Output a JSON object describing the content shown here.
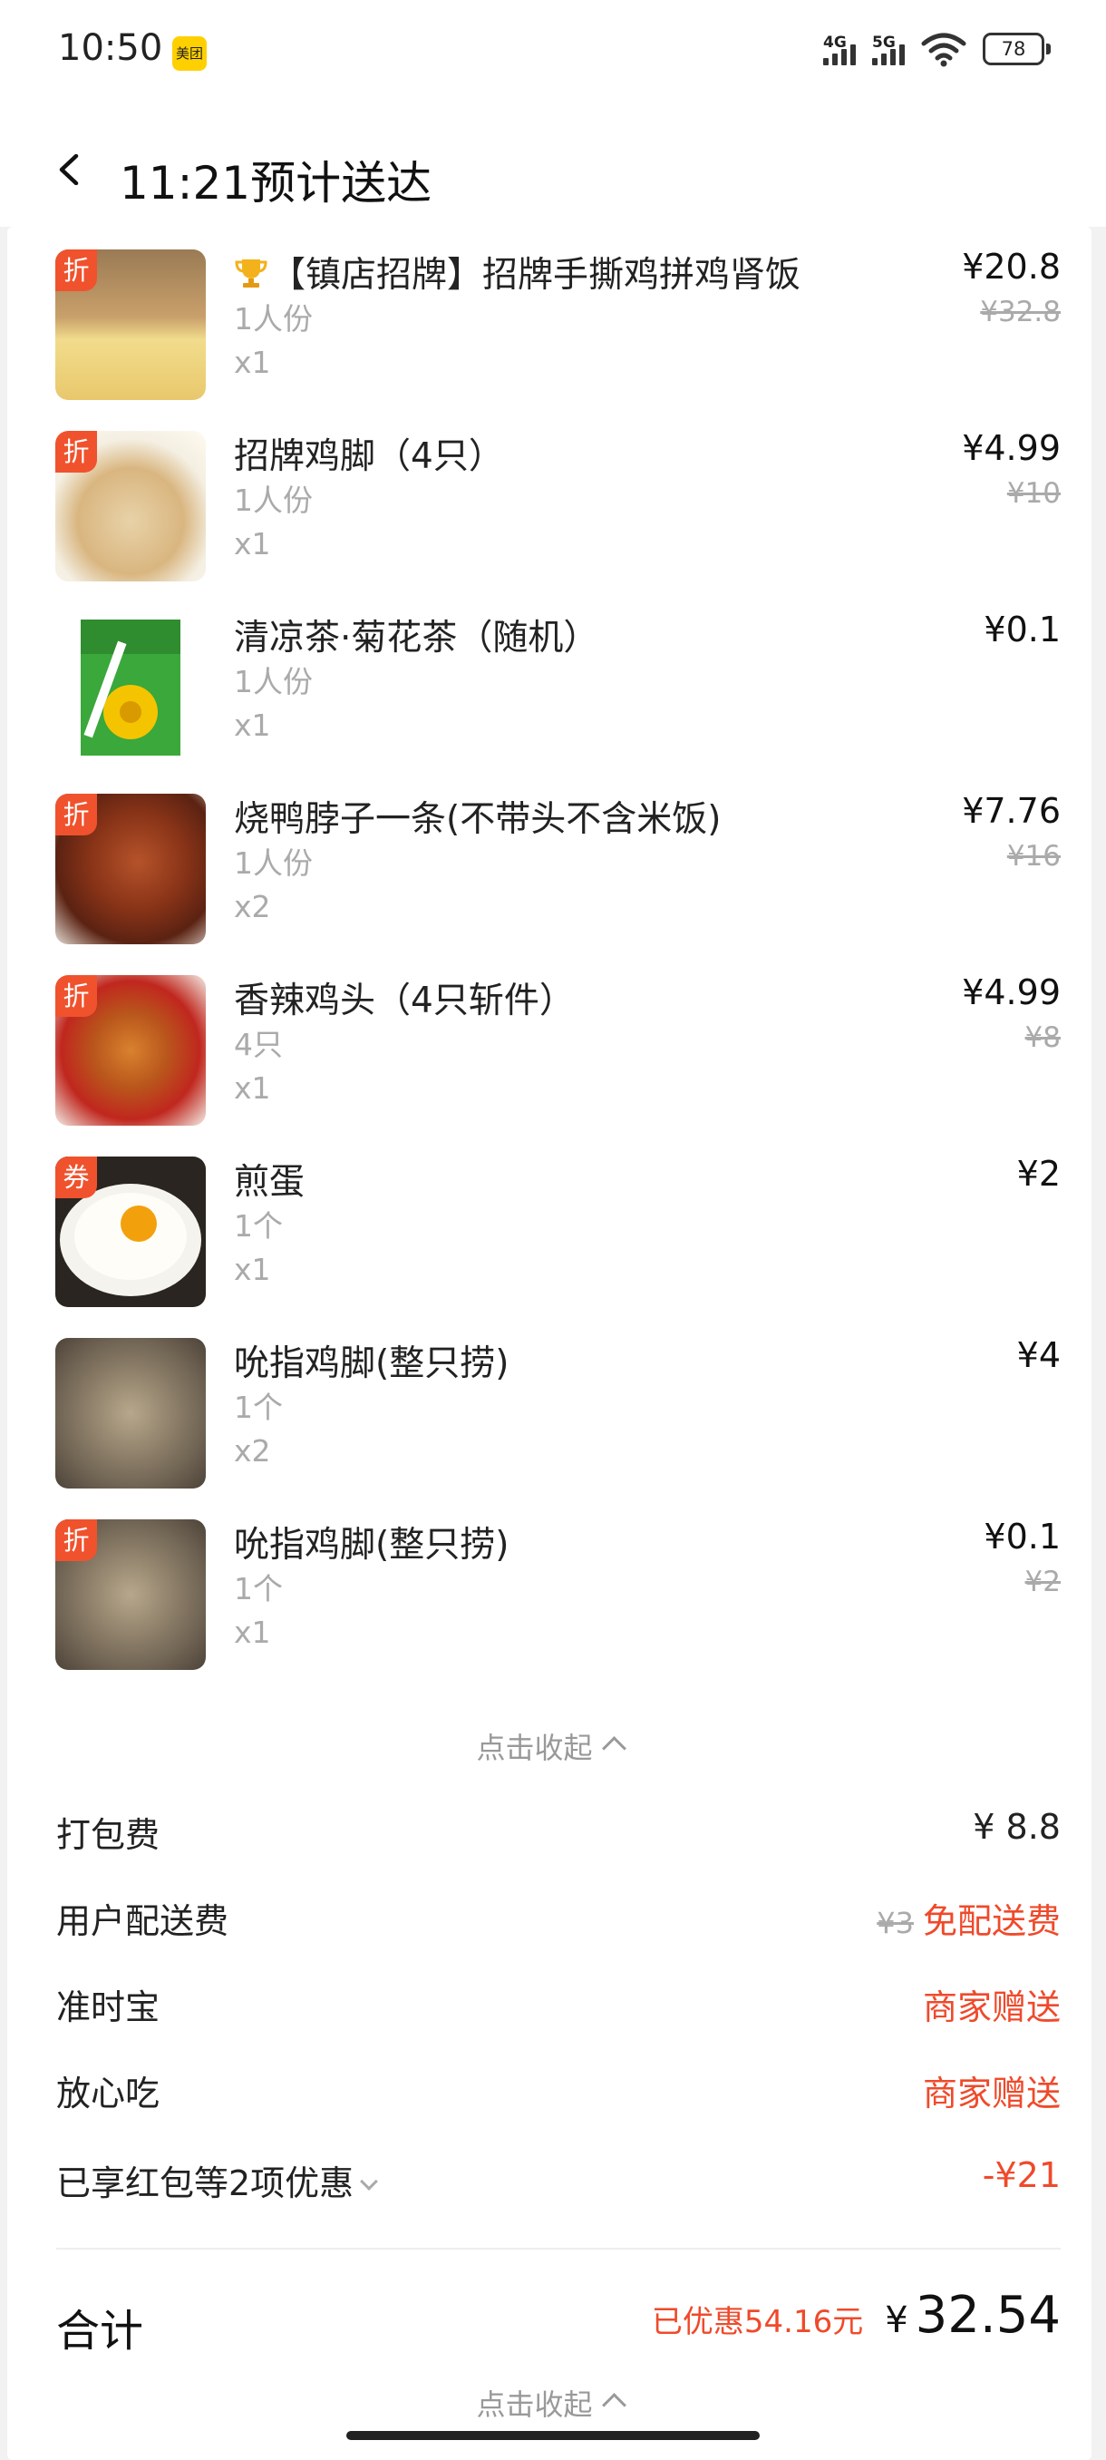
{
  "status_bar": {
    "time": "10:50",
    "app_badge": "美团",
    "network1": "4G",
    "network2": "5G",
    "battery": "78"
  },
  "header": {
    "title": "11:21预计送达"
  },
  "items": [
    {
      "name": "【镇店招牌】招牌手撕鸡拼鸡肾饭",
      "spec": "1人份",
      "qty": "x1",
      "price": "¥20.8",
      "orig_price": "¥32.8",
      "badge": "折",
      "trophy": true
    },
    {
      "name": "招牌鸡脚（4只）",
      "spec": "1人份",
      "qty": "x1",
      "price": "¥4.99",
      "orig_price": "¥10",
      "badge": "折"
    },
    {
      "name": "清凉茶·菊花茶（随机）",
      "spec": "1人份",
      "qty": "x1",
      "price": "¥0.1",
      "orig_price": "",
      "badge": ""
    },
    {
      "name": "烧鸭脖子一条(不带头不含米饭)",
      "spec": "1人份",
      "qty": "x2",
      "price": "¥7.76",
      "orig_price": "¥16",
      "badge": "折"
    },
    {
      "name": "香辣鸡头（4只斩件）",
      "spec": "4只",
      "qty": "x1",
      "price": "¥4.99",
      "orig_price": "¥8",
      "badge": "折"
    },
    {
      "name": "煎蛋",
      "spec": "1个",
      "qty": "x1",
      "price": "¥2",
      "orig_price": "",
      "badge": "券"
    },
    {
      "name": "吮指鸡脚(整只捞)",
      "spec": "1个",
      "qty": "x2",
      "price": "¥4",
      "orig_price": "",
      "badge": ""
    },
    {
      "name": "吮指鸡脚(整只捞)",
      "spec": "1个",
      "qty": "x1",
      "price": "¥0.1",
      "orig_price": "¥2",
      "badge": "折"
    }
  ],
  "collapse_label": "点击收起",
  "fees": {
    "packing_label": "打包费",
    "packing_value": "¥ 8.8",
    "delivery_label": "用户配送费",
    "delivery_orig": "¥3",
    "delivery_value": "免配送费",
    "ontime_label": "准时宝",
    "ontime_value": "商家赠送",
    "safe_label": "放心吃",
    "safe_value": "商家赠送",
    "discount_label": "已享红包等2项优惠",
    "discount_value": "-¥21"
  },
  "total": {
    "label": "合计",
    "saved": "已优惠54.16元",
    "currency": "¥",
    "amount": "32.54"
  },
  "colors": {
    "accent": "#ef4a2b",
    "badge": "#f0522d",
    "muted": "#aaaaaa"
  }
}
